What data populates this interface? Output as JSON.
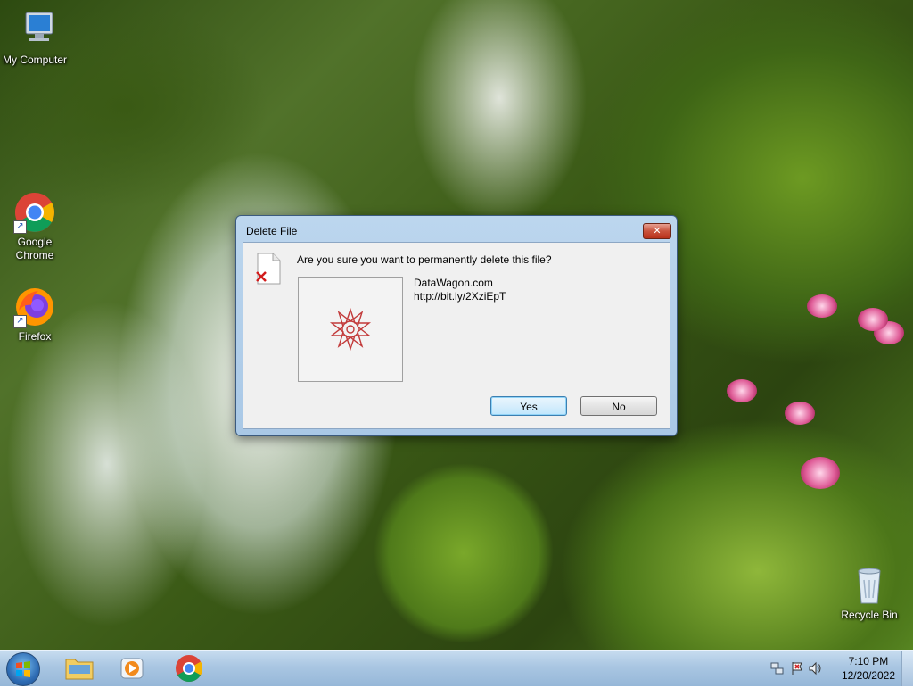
{
  "desktop": {
    "icons": [
      {
        "label": "My Computer"
      },
      {
        "label": "Google Chrome"
      },
      {
        "label": "Firefox"
      },
      {
        "label": "Recycle Bin"
      }
    ]
  },
  "dialog": {
    "title": "Delete File",
    "close_label": "✕",
    "question": "Are you sure you want to permanently delete this file?",
    "file_name": "DataWagon.com",
    "file_url": "http://bit.ly/2XziEpT",
    "yes_label": "Yes",
    "no_label": "No"
  },
  "taskbar": {
    "apps": [
      "windows-explorer-icon",
      "media-player-icon",
      "chrome-icon"
    ],
    "time": "7:10 PM",
    "date": "12/20/2022"
  },
  "colors": {
    "dialog_frame": "#a9c8e6",
    "taskbar": "#a9c6e2",
    "close_button": "#c9533d"
  }
}
